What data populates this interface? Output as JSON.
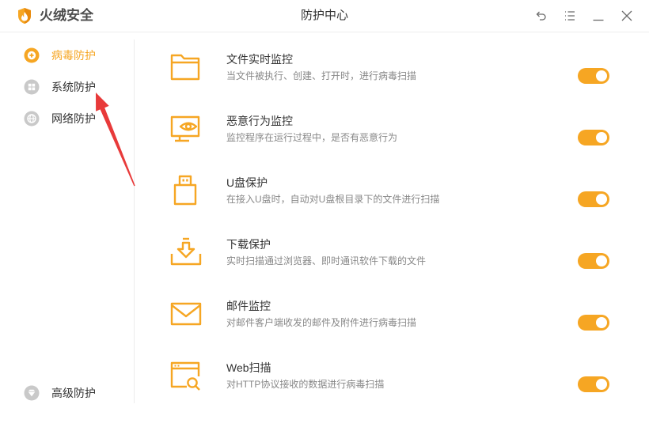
{
  "app": {
    "name": "火绒安全",
    "window_title": "防护中心",
    "logo_icon": "flame-shield-logo-icon"
  },
  "titlebar": {
    "buttons": [
      {
        "icon": "undo-icon"
      },
      {
        "icon": "menu-icon"
      },
      {
        "icon": "minimize-icon"
      },
      {
        "icon": "close-icon"
      }
    ]
  },
  "sidebar": {
    "items": [
      {
        "label": "病毒防护",
        "icon": "virus-protection-icon",
        "active": true
      },
      {
        "label": "系统防护",
        "icon": "windows-icon",
        "active": false
      },
      {
        "label": "网络防护",
        "icon": "globe-icon",
        "active": false
      }
    ],
    "bottom_item": {
      "label": "高级防护",
      "icon": "diamond-icon",
      "active": false
    }
  },
  "features": [
    {
      "title": "文件实时监控",
      "description": "当文件被执行、创建、打开时，进行病毒扫描",
      "icon": "folder-icon",
      "enabled": true
    },
    {
      "title": "恶意行为监控",
      "description": "监控程序在运行过程中，是否有恶意行为",
      "icon": "monitor-eye-icon",
      "enabled": true
    },
    {
      "title": "U盘保护",
      "description": "在接入U盘时，自动对U盘根目录下的文件进行扫描",
      "icon": "usb-drive-icon",
      "enabled": true
    },
    {
      "title": "下载保护",
      "description": "实时扫描通过浏览器、即时通讯软件下载的文件",
      "icon": "download-icon",
      "enabled": true
    },
    {
      "title": "邮件监控",
      "description": "对邮件客户端收发的邮件及附件进行病毒扫描",
      "icon": "mail-icon",
      "enabled": true
    },
    {
      "title": "Web扫描",
      "description": "对HTTP协议接收的数据进行病毒扫描",
      "icon": "web-scan-icon",
      "enabled": true
    }
  ],
  "colors": {
    "accent": "#f6a623",
    "text": "#333333",
    "muted": "#888888",
    "inactive_icon": "#c9c9c9",
    "annotation": "#e83a3a"
  }
}
